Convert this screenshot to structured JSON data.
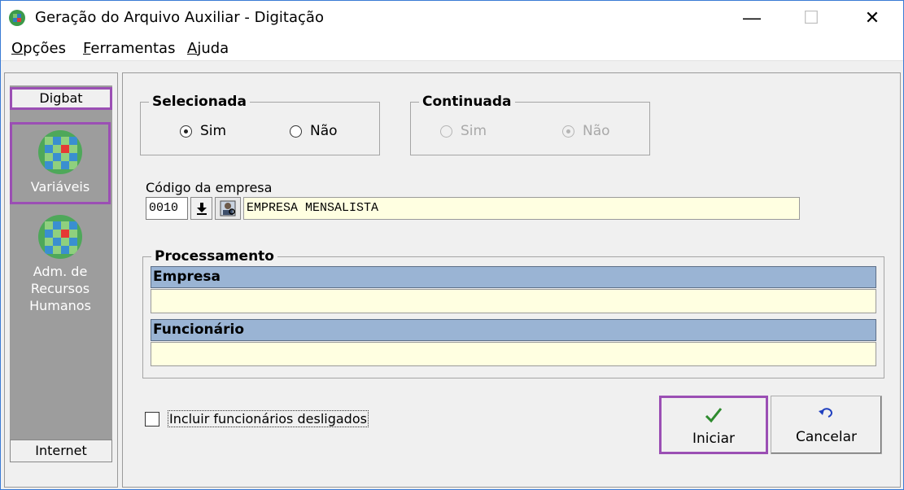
{
  "window": {
    "title": "Geração do Arquivo Auxiliar - Digitação",
    "minimize_glyph": "—",
    "maximize_glyph": "☐",
    "close_glyph": "✕"
  },
  "menu": {
    "items": [
      {
        "label": "Opções",
        "mnemonic": "O"
      },
      {
        "label": "Ferramentas",
        "mnemonic": "F"
      },
      {
        "label": "Ajuda",
        "mnemonic": "A"
      }
    ]
  },
  "sidebar": {
    "top_tab": "Digbat",
    "items": [
      {
        "label": "Variáveis",
        "icon": "globe-icon"
      },
      {
        "label": "Adm. de Recursos Humanos",
        "icon": "globe-icon"
      }
    ],
    "bottom_tab": "Internet"
  },
  "selecionada": {
    "title": "Selecionada",
    "options": [
      {
        "label": "Sim",
        "checked": true,
        "enabled": true
      },
      {
        "label": "Não",
        "checked": false,
        "enabled": true
      }
    ]
  },
  "continuada": {
    "title": "Continuada",
    "options": [
      {
        "label": "Sim",
        "checked": false,
        "enabled": false
      },
      {
        "label": "Não",
        "checked": true,
        "enabled": false
      }
    ]
  },
  "empresa": {
    "label": "Código da empresa",
    "code": "0010",
    "name": "EMPRESA MENSALISTA"
  },
  "processamento": {
    "title": "Processamento",
    "empresa_header": "Empresa",
    "empresa_value": "",
    "funcionario_header": "Funcionário",
    "funcionario_value": ""
  },
  "options": {
    "incluir_desligados_label": "Incluir funcionários desligados",
    "incluir_desligados_checked": false
  },
  "actions": {
    "iniciar_label": "Iniciar",
    "cancelar_label": "Cancelar"
  },
  "colors": {
    "highlight": "#9b4fb4",
    "header_blue": "#9ab4d4",
    "field_yellow": "#ffffe1",
    "sidebar_gray": "#9d9d9d",
    "check_green": "#2e8b2e",
    "undo_blue": "#1f3fbf"
  }
}
